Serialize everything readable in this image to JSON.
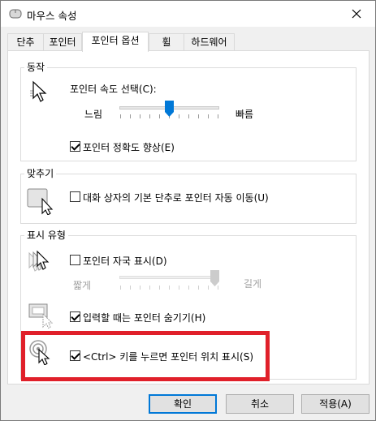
{
  "window": {
    "title": "마우스 속성"
  },
  "tabs": [
    {
      "label": "단추"
    },
    {
      "label": "포인터"
    },
    {
      "label": "포인터 옵션"
    },
    {
      "label": "휠"
    },
    {
      "label": "하드웨어"
    }
  ],
  "motion": {
    "legend": "동작",
    "speed_label": "포인터 속도 선택(C):",
    "slow_label": "느림",
    "fast_label": "빠름",
    "speed_value": 0.5,
    "precision_label": "포인터 정확도 향상(E)",
    "precision_checked": true
  },
  "snapto": {
    "legend": "맞추기",
    "label": "대화 상자의 기본 단추로 포인터 자동 이동(U)",
    "checked": false
  },
  "visibility": {
    "legend": "표시 유형",
    "trails_label": "포인터 자국 표시(D)",
    "trails_checked": false,
    "short_label": "짧게",
    "long_label": "길게",
    "trails_value": 1.0,
    "hide_label": "입력할 때는 포인터 숨기기(H)",
    "hide_checked": true,
    "ctrl_label": "<Ctrl> 키를 누르면 포인터 위치 표시(S)",
    "ctrl_checked": true
  },
  "buttons": {
    "ok": "확인",
    "cancel": "취소",
    "apply": "적용(A)"
  },
  "colors": {
    "highlight": "#e0202a",
    "default_button_border": "#0078d7"
  }
}
